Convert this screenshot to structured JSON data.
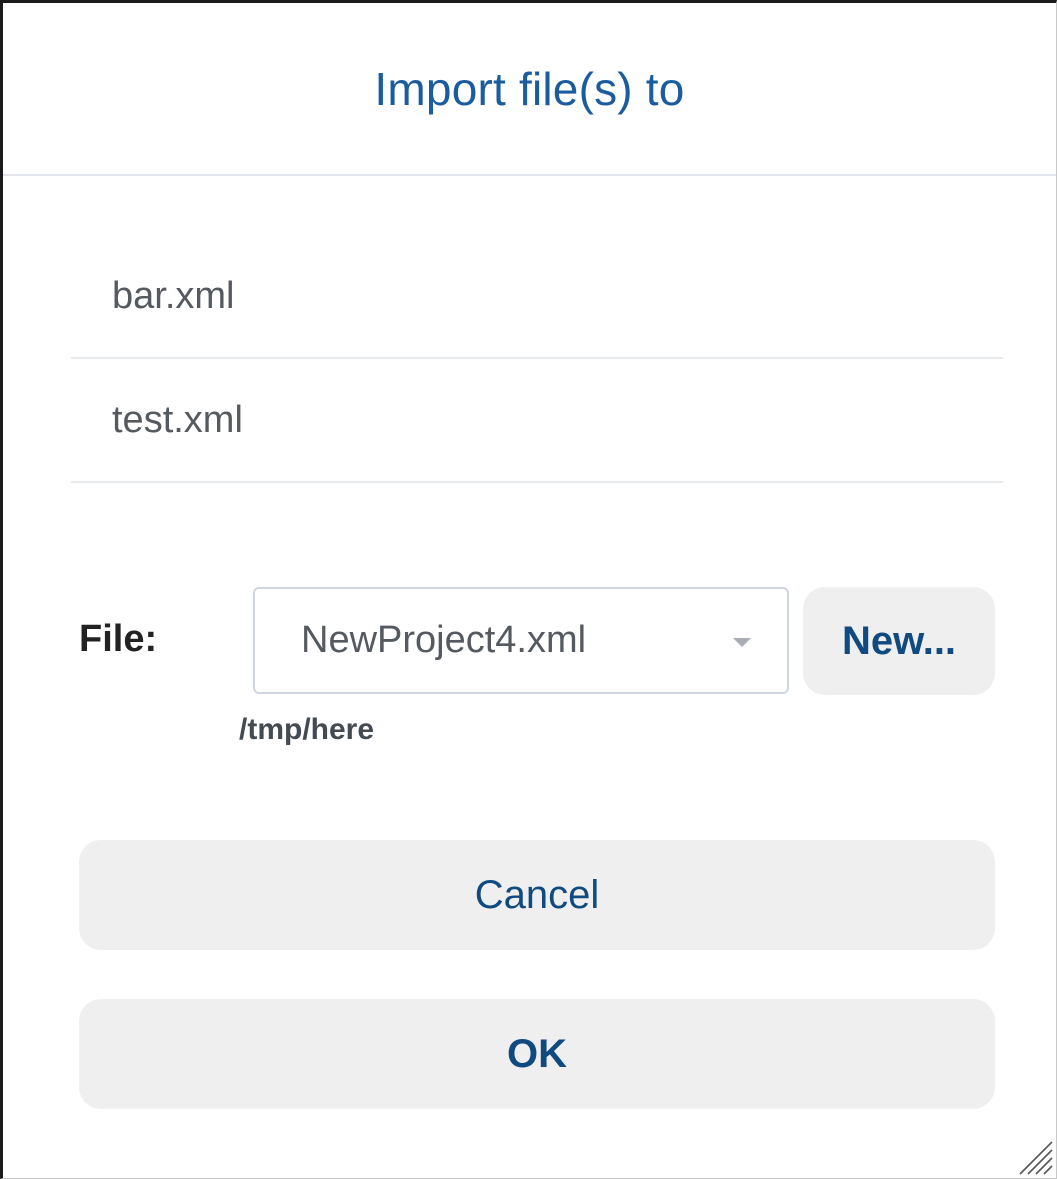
{
  "dialog": {
    "title": "Import file(s) to"
  },
  "files": [
    {
      "name": "bar.xml"
    },
    {
      "name": "test.xml"
    }
  ],
  "file_selector": {
    "label": "File:",
    "selected": "NewProject4.xml",
    "path": "/tmp/here",
    "new_label": "New..."
  },
  "actions": {
    "cancel_label": "Cancel",
    "ok_label": "OK"
  },
  "colors": {
    "accent": "#1b5c9e",
    "button_text": "#0f4a80",
    "button_bg": "#efefef"
  },
  "icons": {
    "dropdown": "chevron-down-icon",
    "resize": "resize-grip-icon"
  }
}
